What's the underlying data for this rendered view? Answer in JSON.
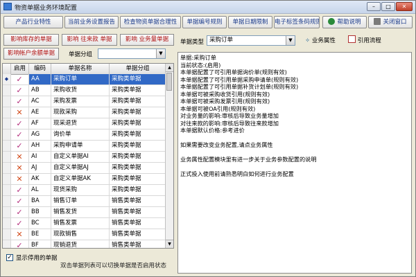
{
  "window": {
    "title": "物资单据业务环境配置",
    "min": "–",
    "max": "□",
    "close": "✕"
  },
  "toolbar": {
    "buttons": [
      {
        "label": "产品行业特性"
      },
      {
        "label": "当前业务设置报告"
      },
      {
        "label": "检查物资单据合理性"
      },
      {
        "label": "单据编号规则"
      },
      {
        "label": "单据日期限制"
      },
      {
        "label": "电子标签条码规则"
      },
      {
        "label": "帮助说明"
      },
      {
        "label": "关闭窗口"
      }
    ]
  },
  "left": {
    "buttons": {
      "inventory": "影响库存的单据",
      "receivable": "影响 往来款 单据",
      "business": "影响 业务量单据",
      "account": "影响帐户余额单据"
    },
    "group_label": "单据分组",
    "group_value": "",
    "columns": {
      "enabled": "启用",
      "code": "编码",
      "name": "单据名称",
      "group": "单据分组"
    },
    "rows": [
      {
        "enabled": true,
        "code": "AA",
        "name": "采购订单",
        "group": "采购类单据"
      },
      {
        "enabled": true,
        "code": "AB",
        "name": "采购收货",
        "group": "采购类单据"
      },
      {
        "enabled": true,
        "code": "AC",
        "name": "采购发票",
        "group": "采购类单据"
      },
      {
        "enabled": false,
        "code": "AE",
        "name": "现款采购",
        "group": "采购类单据"
      },
      {
        "enabled": true,
        "code": "AF",
        "name": "现采退货",
        "group": "采购类单据"
      },
      {
        "enabled": true,
        "code": "AG",
        "name": "询价单",
        "group": "采购类单据"
      },
      {
        "enabled": true,
        "code": "AH",
        "name": "采购申请单",
        "group": "采购类单据"
      },
      {
        "enabled": false,
        "code": "AI",
        "name": "自定义单据AI",
        "group": "采购类单据"
      },
      {
        "enabled": false,
        "code": "AJ",
        "name": "自定义单据AJ",
        "group": "采购类单据"
      },
      {
        "enabled": false,
        "code": "AK",
        "name": "自定义单据AK",
        "group": "采购类单据"
      },
      {
        "enabled": true,
        "code": "AL",
        "name": "现货采购",
        "group": "采购类单据"
      },
      {
        "enabled": true,
        "code": "BA",
        "name": "销售订单",
        "group": "销售类单据"
      },
      {
        "enabled": true,
        "code": "BB",
        "name": "销售发货",
        "group": "销售类单据"
      },
      {
        "enabled": true,
        "code": "BC",
        "name": "销售发票",
        "group": "销售类单据"
      },
      {
        "enabled": false,
        "code": "BE",
        "name": "现款销售",
        "group": "销售类单据"
      },
      {
        "enabled": true,
        "code": "BF",
        "name": "现销退货",
        "group": "销售类单据"
      }
    ],
    "show_disabled_label": "显示停用的单据",
    "hint": "双击单据列表可以切换单据是否启用状态"
  },
  "right": {
    "type_label": "单据类型",
    "type_value": "采购订单",
    "attr_button": "业务属性",
    "flow_button": "引用流程",
    "content": [
      "单据:采购订单",
      "      当前状态:(启用)",
      "      本单据配置了可引用单据询价单(规则有效)",
      "      本单据配置了可引用单据采购申请单(规则有效)",
      "      本单据配置了可引用单据补货计划单(规则有效)",
      "      本单据可被采购收货引用(规则有效)",
      "      本单据可被采购发票引用(规则有效)",
      "      本单据可被OA引用(规则有效)",
      "      对业务量的影响:审核后导致业务量增加",
      "      对往来款的影响:审核后导致往来款增加",
      "      本单据默认价格:参考进价",
      "",
      "如果需要改变业务配置,请点业务属性",
      "",
      "业务属性配置模块里有进一步关于业务参数配置的说明",
      "",
      "正式投入使用前请熟悉明白如何进行业务配置"
    ]
  },
  "icons": {
    "ok_glyph": "✓",
    "no_glyph": "✕",
    "row_pointer": "◆"
  },
  "colors": {
    "selection": "#3169c6",
    "enabled_mark": "#b22a7a",
    "disabled_mark": "#d24a1a",
    "left_button_text": "#b01010",
    "toolbar_text": "#1a3a8a"
  }
}
